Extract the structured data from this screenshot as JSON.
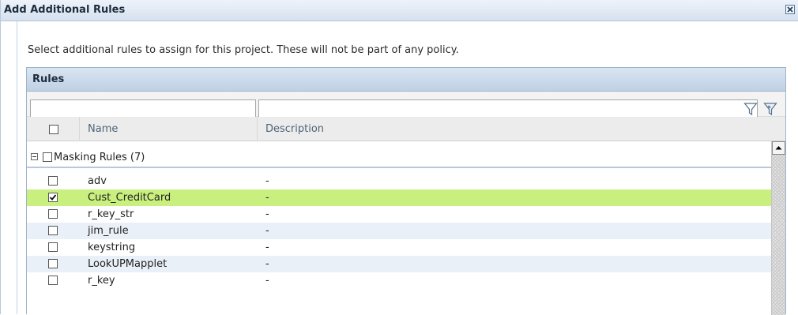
{
  "dialog": {
    "title": "Add Additional Rules",
    "close_icon": "close-icon"
  },
  "intro_text": "Select additional rules to assign for this project. These will not be part of any policy.",
  "panel": {
    "title": "Rules",
    "filters": {
      "name_value": "",
      "description_value": ""
    },
    "icons": {
      "filter": "filter-icon",
      "clear_filter": "clear-filter-icon"
    },
    "columns": {
      "name": "Name",
      "description": "Description"
    },
    "group": {
      "label": "Masking Rules (7)",
      "expanded": true
    },
    "rows": [
      {
        "name": "adv",
        "description": "-",
        "checked": false
      },
      {
        "name": "Cust_CreditCard",
        "description": "-",
        "checked": true
      },
      {
        "name": "r_key_str",
        "description": "-",
        "checked": false
      },
      {
        "name": "jim_rule",
        "description": "-",
        "checked": false
      },
      {
        "name": "keystring",
        "description": "-",
        "checked": false
      },
      {
        "name": "LookUPMapplet",
        "description": "-",
        "checked": false
      },
      {
        "name": "r_key",
        "description": "-",
        "checked": false
      }
    ]
  },
  "colors": {
    "selected_row": "#c9f07e",
    "alt_row": "#eaf0f7",
    "header_blue": "#bfd1e4"
  }
}
